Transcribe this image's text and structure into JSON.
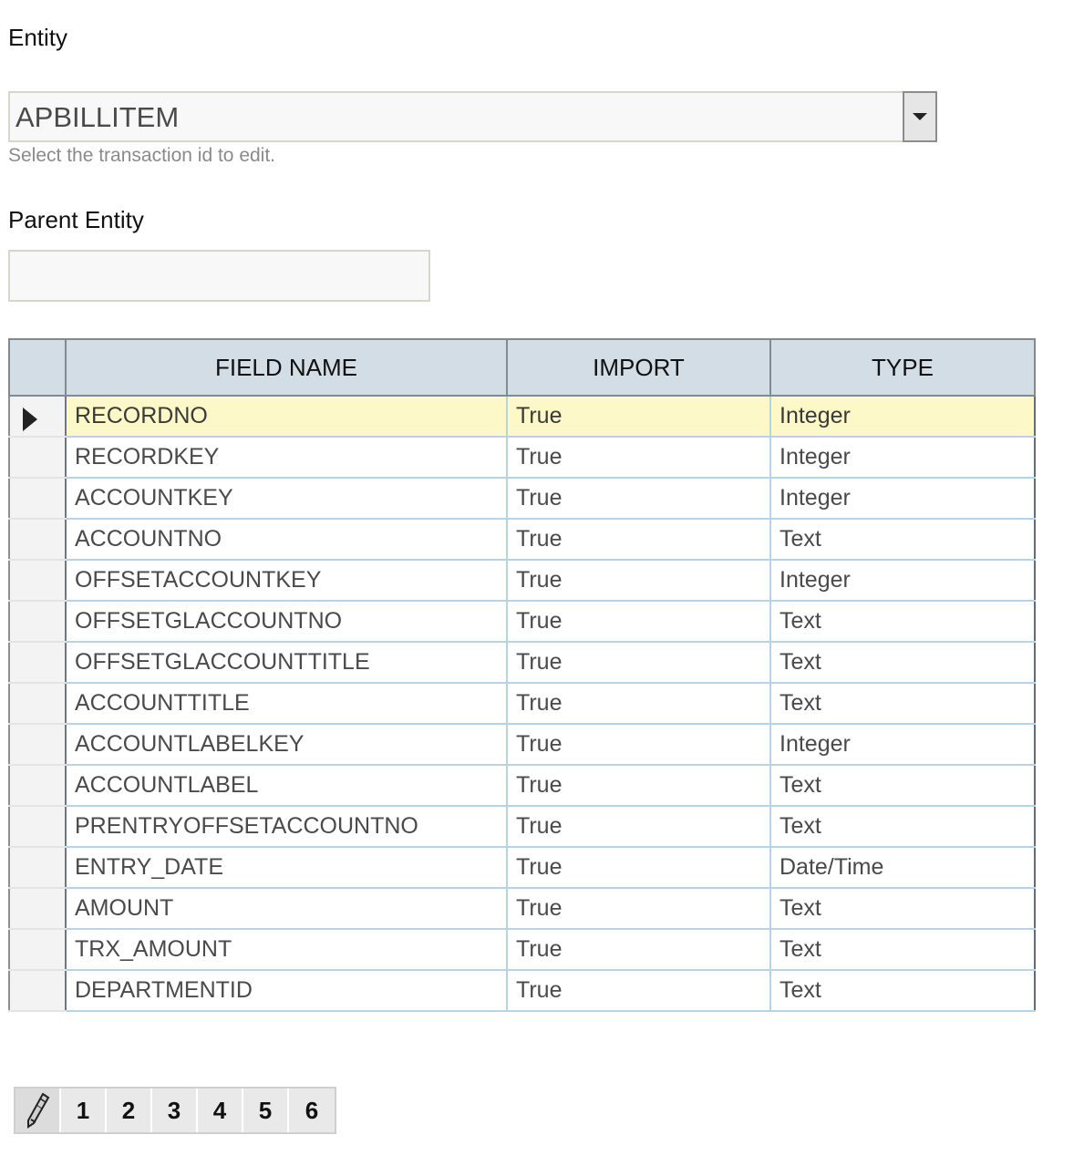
{
  "entity": {
    "label": "Entity",
    "value": "APBILLITEM",
    "hint": "Select the transaction id to edit."
  },
  "parent_entity": {
    "label": "Parent Entity",
    "value": ""
  },
  "grid": {
    "columns": [
      "FIELD NAME",
      "IMPORT",
      "TYPE"
    ],
    "rows": [
      {
        "field": "RECORDNO",
        "import": "True",
        "type": "Integer"
      },
      {
        "field": "RECORDKEY",
        "import": "True",
        "type": "Integer"
      },
      {
        "field": "ACCOUNTKEY",
        "import": "True",
        "type": "Integer"
      },
      {
        "field": "ACCOUNTNO",
        "import": "True",
        "type": "Text"
      },
      {
        "field": "OFFSETACCOUNTKEY",
        "import": "True",
        "type": "Integer"
      },
      {
        "field": "OFFSETGLACCOUNTNO",
        "import": "True",
        "type": "Text"
      },
      {
        "field": "OFFSETGLACCOUNTTITLE",
        "import": "True",
        "type": "Text"
      },
      {
        "field": "ACCOUNTTITLE",
        "import": "True",
        "type": "Text"
      },
      {
        "field": "ACCOUNTLABELKEY",
        "import": "True",
        "type": "Integer"
      },
      {
        "field": "ACCOUNTLABEL",
        "import": "True",
        "type": "Text"
      },
      {
        "field": "PRENTRYOFFSETACCOUNTNO",
        "import": "True",
        "type": "Text"
      },
      {
        "field": "ENTRY_DATE",
        "import": "True",
        "type": "Date/Time"
      },
      {
        "field": "AMOUNT",
        "import": "True",
        "type": "Text"
      },
      {
        "field": "TRX_AMOUNT",
        "import": "True",
        "type": "Text"
      },
      {
        "field": "DEPARTMENTID",
        "import": "True",
        "type": "Text"
      }
    ],
    "selected_row_index": 0
  },
  "pager": {
    "edit_icon": "pencil-icon",
    "pages": [
      "1",
      "2",
      "3",
      "4",
      "5",
      "6"
    ]
  }
}
